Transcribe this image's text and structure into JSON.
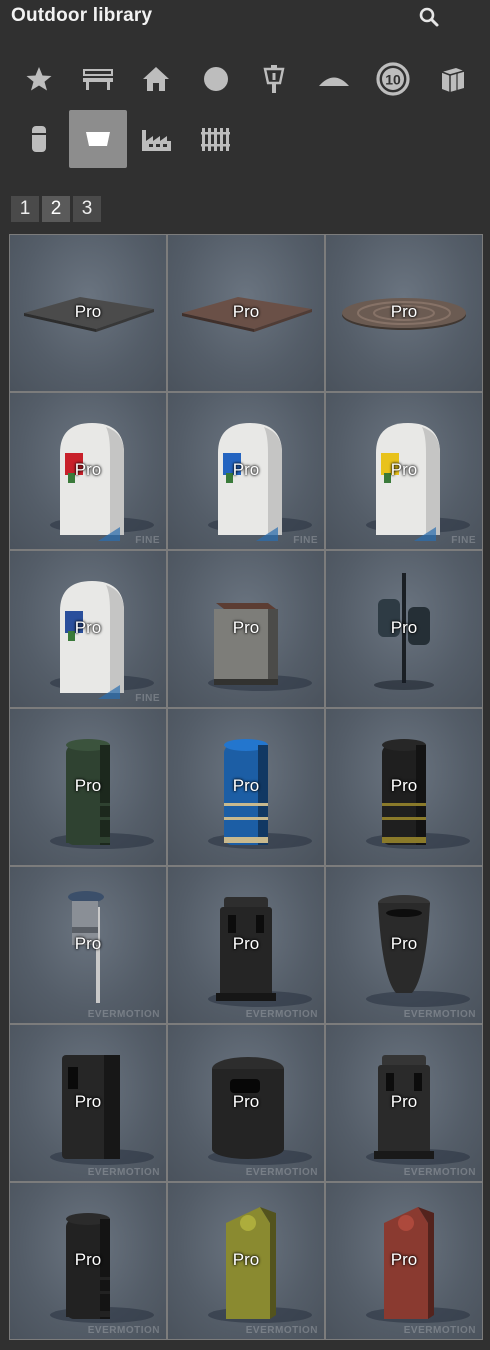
{
  "header": {
    "title": "Outdoor library"
  },
  "categories": [
    {
      "icon": "star-icon",
      "active": false
    },
    {
      "icon": "bench-icon",
      "active": false
    },
    {
      "icon": "house-icon",
      "active": false
    },
    {
      "icon": "circle-icon",
      "active": false
    },
    {
      "icon": "street-lamp-icon",
      "active": false
    },
    {
      "icon": "dome-icon",
      "active": false
    },
    {
      "icon": "speed-limit-10-icon",
      "active": false,
      "text": "10"
    },
    {
      "icon": "cube-icon",
      "active": false
    },
    {
      "icon": "bollard-icon",
      "active": false
    },
    {
      "icon": "trash-bin-icon",
      "active": true
    },
    {
      "icon": "factory-icon",
      "active": false
    },
    {
      "icon": "fence-icon",
      "active": false
    }
  ],
  "pages": [
    "1",
    "2",
    "3"
  ],
  "current_page": "2",
  "items": [
    {
      "badge": "Pro",
      "kind": "square-mat",
      "color": "#4b4b4b",
      "watermark": ""
    },
    {
      "badge": "Pro",
      "kind": "square-mat",
      "color": "#6a5047",
      "watermark": ""
    },
    {
      "badge": "Pro",
      "kind": "round-mat",
      "color": "#6b5b52",
      "watermark": ""
    },
    {
      "badge": "Pro",
      "kind": "dome-bin",
      "color": "#e8e8e6",
      "accent": "#c8202a",
      "watermark": "FINE"
    },
    {
      "badge": "Pro",
      "kind": "dome-bin",
      "color": "#e8e8e6",
      "accent": "#2464c0",
      "watermark": "FINE"
    },
    {
      "badge": "Pro",
      "kind": "dome-bin",
      "color": "#e8e8e6",
      "accent": "#e8c21c",
      "watermark": "FINE"
    },
    {
      "badge": "Pro",
      "kind": "dome-bin",
      "color": "#e8e8e6",
      "accent": "#2a4f9c",
      "watermark": "FINE"
    },
    {
      "badge": "Pro",
      "kind": "square-bin",
      "color": "#7d7d79",
      "accent": "#5c3d33",
      "watermark": ""
    },
    {
      "badge": "Pro",
      "kind": "pole-double",
      "color": "#2e3b44",
      "watermark": ""
    },
    {
      "badge": "Pro",
      "kind": "round-bin",
      "color": "#2f4231",
      "accent": "#2f4231",
      "watermark": ""
    },
    {
      "badge": "Pro",
      "kind": "round-bin",
      "color": "#1c5ea5",
      "accent": "#c8b98e",
      "watermark": ""
    },
    {
      "badge": "Pro",
      "kind": "round-bin",
      "color": "#1f1f1f",
      "accent": "#8a7a2a",
      "watermark": ""
    },
    {
      "badge": "Pro",
      "kind": "pole-bin",
      "color": "#3b4f6a",
      "watermark": "EVERMOTION"
    },
    {
      "badge": "Pro",
      "kind": "roof-bin",
      "color": "#252525",
      "watermark": "EVERMOTION"
    },
    {
      "badge": "Pro",
      "kind": "cone-bin",
      "color": "#2a2a2a",
      "watermark": "EVERMOTION"
    },
    {
      "badge": "Pro",
      "kind": "box-bin",
      "color": "#262626",
      "watermark": "EVERMOTION"
    },
    {
      "badge": "Pro",
      "kind": "drum-bin",
      "color": "#242424",
      "watermark": "EVERMOTION"
    },
    {
      "badge": "Pro",
      "kind": "roof-bin",
      "color": "#2a2a2a",
      "watermark": "EVERMOTION"
    },
    {
      "badge": "Pro",
      "kind": "round-bin",
      "color": "#222222",
      "accent": "#222222",
      "watermark": "EVERMOTION"
    },
    {
      "badge": "Pro",
      "kind": "slant-bin",
      "color": "#8a8a30",
      "watermark": "EVERMOTION"
    },
    {
      "badge": "Pro",
      "kind": "slant-bin",
      "color": "#8a3a30",
      "watermark": "EVERMOTION"
    }
  ]
}
